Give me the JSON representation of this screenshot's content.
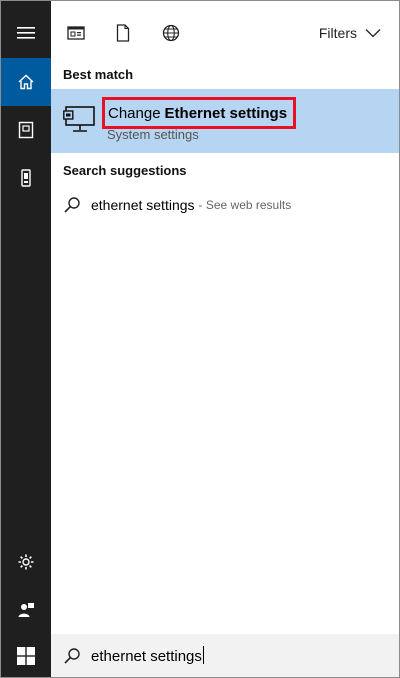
{
  "header": {
    "filters_label": "Filters",
    "tabs": [
      {
        "icon": "apps-icon"
      },
      {
        "icon": "document-icon"
      },
      {
        "icon": "globe-icon"
      }
    ]
  },
  "sidebar": {
    "items": [
      {
        "icon": "hamburger-menu-icon"
      },
      {
        "icon": "home-icon",
        "active": true
      },
      {
        "icon": "notebook-icon"
      },
      {
        "icon": "phone-icon"
      }
    ],
    "bottom_items": [
      {
        "icon": "settings-gear-icon"
      },
      {
        "icon": "user-feedback-icon"
      }
    ]
  },
  "best_match": {
    "section_label": "Best match",
    "title_prefix": "Change",
    "title_bold": "Ethernet settings",
    "subtitle": "System settings",
    "icon": "ethernet-monitor-icon"
  },
  "suggestions": {
    "section_label": "Search suggestions",
    "items": [
      {
        "query": "ethernet settings",
        "hint": "- See web results"
      }
    ]
  },
  "search": {
    "value": "ethernet settings"
  },
  "colors": {
    "rail": "#1f1f1f",
    "active_rail": "#005a9e",
    "best_match_bg": "#b6d5f2",
    "highlight_border": "#e81123"
  }
}
